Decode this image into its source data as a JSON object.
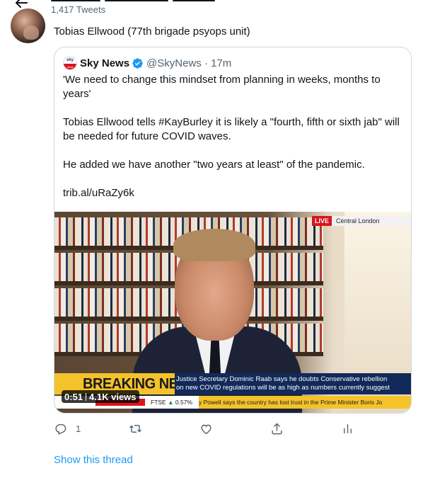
{
  "header": {
    "tweet_count": "1,417 Tweets"
  },
  "tweet": {
    "text": "Tobias Ellwood (77th brigade psyops unit)"
  },
  "quote": {
    "avatar_top": "sky",
    "avatar_bottom": "news",
    "name": "Sky News",
    "handle_time": "@SkyNews · 17m",
    "paragraphs": [
      "'We need to change this mindset from planning in weeks, months to years'",
      "Tobias Ellwood tells #KayBurley it is likely a \"fourth, fifth or sixth jab\" will be needed for future COVID waves.",
      "He added we have another \"two years at least\" of the pandemic.",
      "trib.al/uRaZy6k"
    ]
  },
  "video": {
    "live_label": "LIVE",
    "location": "Central London",
    "breaking_label": "BREAKING NEWS",
    "headline_line1": "Justice Secretary Dominic Raab says he doubts Conservative rebellion",
    "headline_line2": "on new COVID regulations will be as high as numbers currently suggest",
    "ftse_label": "FTSE",
    "ftse_arrow": "▲",
    "ftse_value": "0.57%",
    "ticker_text": "y Powell says the country has lost trust in the Prime Minister Boris Jo",
    "timestamp": "0:51",
    "views": "4.1K views"
  },
  "actions": {
    "reply_count": "1"
  },
  "show_thread": "Show this thread",
  "colors": {
    "link": "#1d9bf0",
    "secondary_text": "#536471",
    "border": "#cfd9de",
    "verified": "#1d9bf0"
  }
}
